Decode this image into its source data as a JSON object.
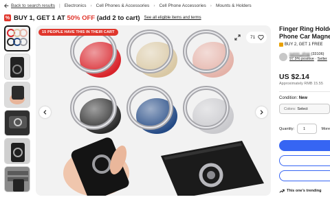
{
  "breadcrumb": {
    "back_label": "Back to search results",
    "items": [
      "Electronics",
      "Cell Phones & Accessories",
      "Cell Phone Accessories",
      "Mounts & Holders"
    ]
  },
  "promo": {
    "part1": "BUY 1, GET 1 AT ",
    "highlight": "50% OFF",
    "part2": " (add 2 to cart)",
    "link": "See all eligible items and terms"
  },
  "gallery": {
    "badge": "15 PEOPLE HAVE THIS IN THEIR CART",
    "watch_count": "71"
  },
  "product": {
    "title_line1": "Finger Ring Holder",
    "title_line2": "Phone Car Magnet",
    "offer": "BUY 2, GET 1 FREE",
    "seller_name": "sunnn_shop",
    "seller_count": "(33106)",
    "seller_positive": "97.9% positive",
    "seller_link": "Seller",
    "price": "US $2.14",
    "approx": "Approximately RMB 15.55",
    "condition_label": "Condition:",
    "condition_value": "New",
    "colors_label": "Colors:",
    "colors_value": "Select",
    "quantity_label": "Quantity:",
    "quantity_value": "1",
    "quantity_more": "More",
    "trending": "This one's trending"
  },
  "colors": {
    "red": "#d8232a",
    "gold": "#d9c8a4",
    "rose": "#e4b2a8",
    "black": "#2a2a2a",
    "navy": "#244a85",
    "silver": "#c9c9cd",
    "accent": "#3665f3",
    "alert": "#e0362c"
  }
}
